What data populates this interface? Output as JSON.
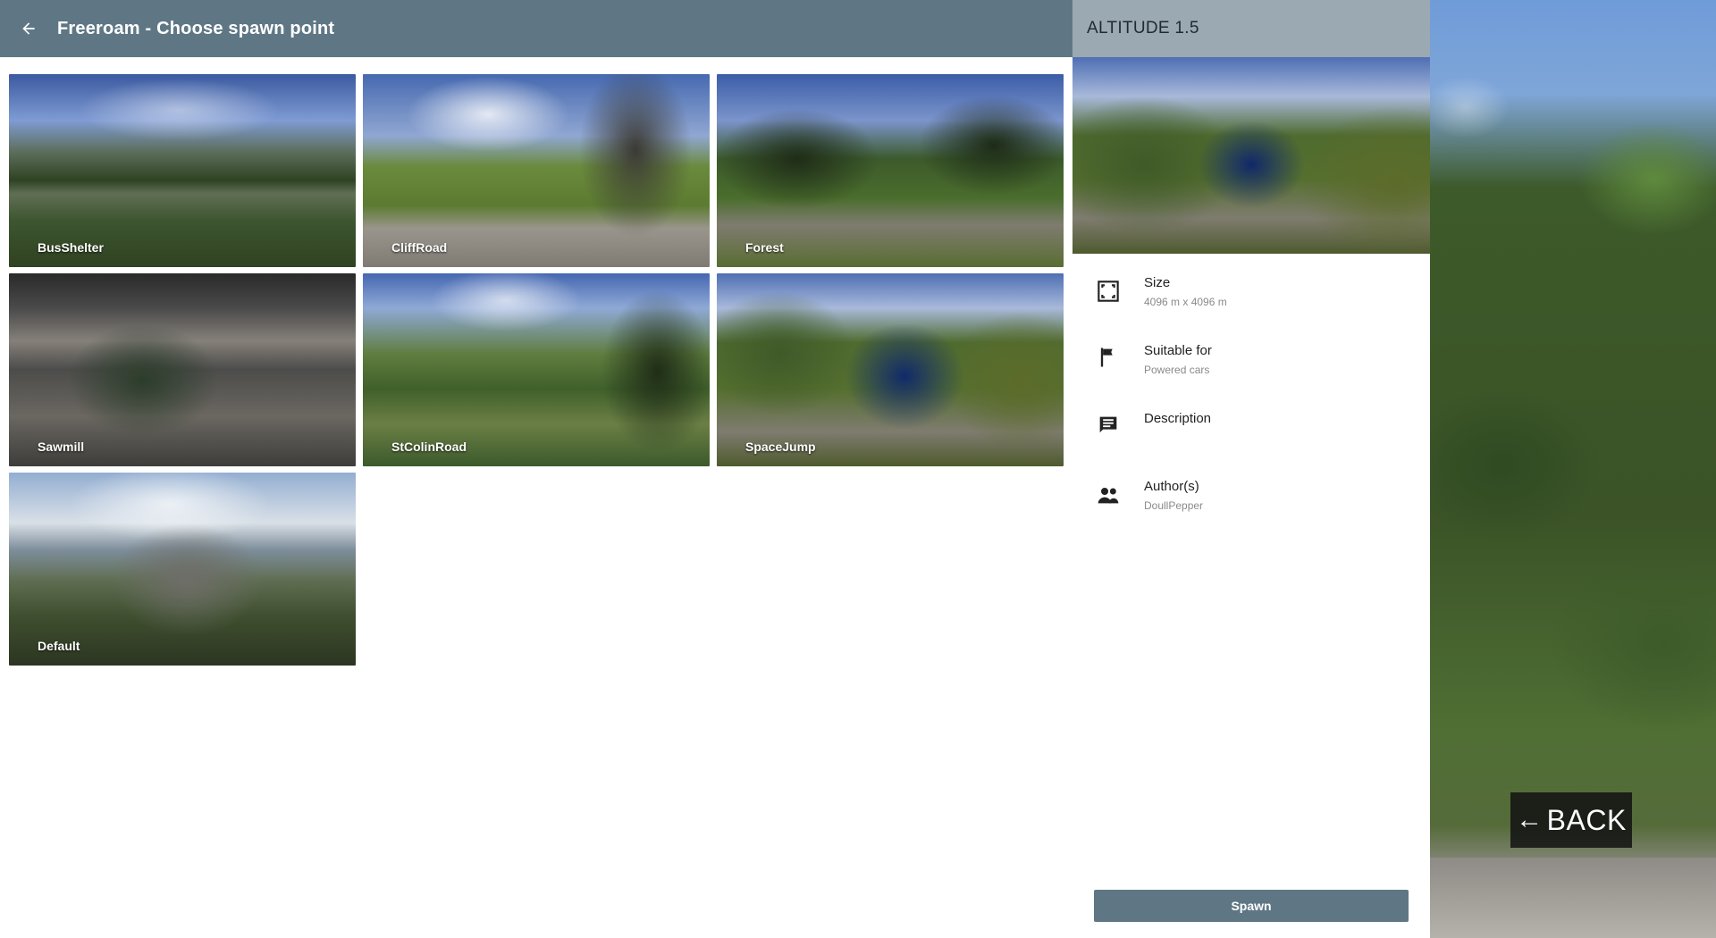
{
  "header": {
    "title": "Freeroam - Choose spawn point"
  },
  "spawn_points": [
    {
      "label": "BusShelter"
    },
    {
      "label": "CliffRoad"
    },
    {
      "label": "Forest"
    },
    {
      "label": "Sawmill"
    },
    {
      "label": "StColinRoad"
    },
    {
      "label": "SpaceJump"
    },
    {
      "label": "Default"
    }
  ],
  "details": {
    "title": "ALTITUDE 1.5",
    "size_label": "Size",
    "size_value": "4096 m x 4096 m",
    "suitable_label": "Suitable for",
    "suitable_value": "Powered cars",
    "description_label": "Description",
    "authors_label": "Author(s)",
    "authors_value": "DoullPepper",
    "spawn_label": "Spawn"
  },
  "overlay": {
    "back_arrow": "←",
    "back_label": "BACK"
  }
}
